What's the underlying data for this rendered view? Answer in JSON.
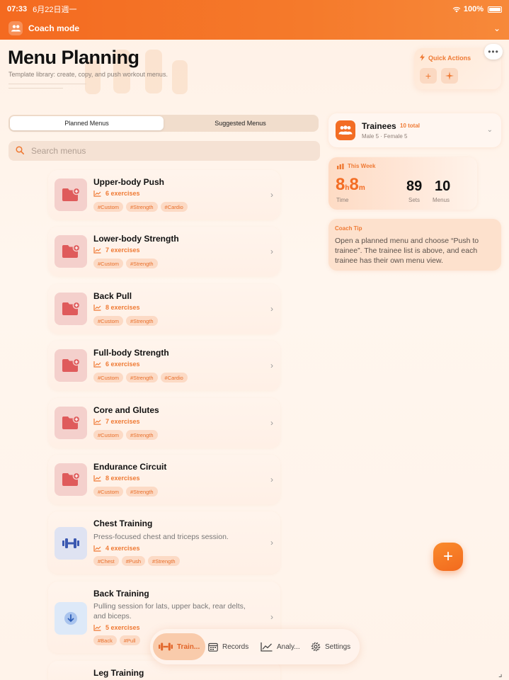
{
  "status_bar": {
    "time": "07:33",
    "date": "6月22日週一",
    "battery": "100%"
  },
  "coach_mode": {
    "label": "Coach mode"
  },
  "header": {
    "title": "Menu Planning",
    "subtitle": "Template library: create, copy, and push workout menus."
  },
  "quick_actions": {
    "title": "Quick Actions",
    "add_symbol": "+",
    "more_symbol": "•••"
  },
  "segmented": {
    "tabs": [
      "Planned Menus",
      "Suggested Menus"
    ],
    "selected": "Planned Menus"
  },
  "search": {
    "placeholder": "Search menus"
  },
  "menus": [
    {
      "title": "Upper-body Push",
      "exercises": "6 exercises",
      "tags": [
        "#Custom",
        "#Strength",
        "#Cardio"
      ],
      "icon": "folder-plus-icon"
    },
    {
      "title": "Lower-body Strength",
      "exercises": "7 exercises",
      "tags": [
        "#Custom",
        "#Strength"
      ],
      "icon": "folder-plus-icon"
    },
    {
      "title": "Back Pull",
      "exercises": "8 exercises",
      "tags": [
        "#Custom",
        "#Strength"
      ],
      "icon": "folder-plus-icon"
    },
    {
      "title": "Full-body Strength",
      "exercises": "6 exercises",
      "tags": [
        "#Custom",
        "#Strength",
        "#Cardio"
      ],
      "icon": "folder-plus-icon"
    },
    {
      "title": "Core and Glutes",
      "exercises": "7 exercises",
      "tags": [
        "#Custom",
        "#Strength"
      ],
      "icon": "folder-plus-icon"
    },
    {
      "title": "Endurance Circuit",
      "exercises": "8 exercises",
      "tags": [
        "#Custom",
        "#Strength"
      ],
      "icon": "folder-plus-icon"
    },
    {
      "title": "Chest Training",
      "description": "Press-focused chest and triceps session.",
      "exercises": "4 exercises",
      "tags": [
        "#Chest",
        "#Push",
        "#Strength"
      ],
      "icon": "dumbbell-icon"
    },
    {
      "title": "Back Training",
      "description": "Pulling session for lats, upper back, rear delts, and biceps.",
      "exercises": "5 exercises",
      "tags": [
        "#Back",
        "#Pull"
      ],
      "icon": "arrow-down-circle-icon"
    },
    {
      "title": "Leg Training"
    }
  ],
  "trainees": {
    "title": "Trainees",
    "count": "10 total",
    "breakdown": "Male 5 · Female 5"
  },
  "this_week": {
    "title": "This Week",
    "time_hours": "8",
    "time_h_unit": "h",
    "time_minutes": "8",
    "time_m_unit": "m",
    "time_label": "Time",
    "sets": "89",
    "sets_label": "Sets",
    "menus": "10",
    "menus_label": "Menus"
  },
  "coach_tip": {
    "title": "Coach Tip",
    "text": "Open a planned menu and choose “Push to trainee”. The trainee list is above, and each trainee has their own menu view."
  },
  "fab": {
    "symbol": "+"
  },
  "tabbar": {
    "tabs": [
      {
        "label": "Train...",
        "icon": "dumbbell-icon",
        "active": true
      },
      {
        "label": "Records",
        "icon": "calendar-icon",
        "active": false
      },
      {
        "label": "Analy...",
        "icon": "chart-icon",
        "active": false
      },
      {
        "label": "Settings",
        "icon": "gear-icon",
        "active": false
      }
    ]
  },
  "colors": {
    "accent": "#f36d24",
    "tag_bg": "#fcdac5",
    "background": "#fff3ea"
  }
}
